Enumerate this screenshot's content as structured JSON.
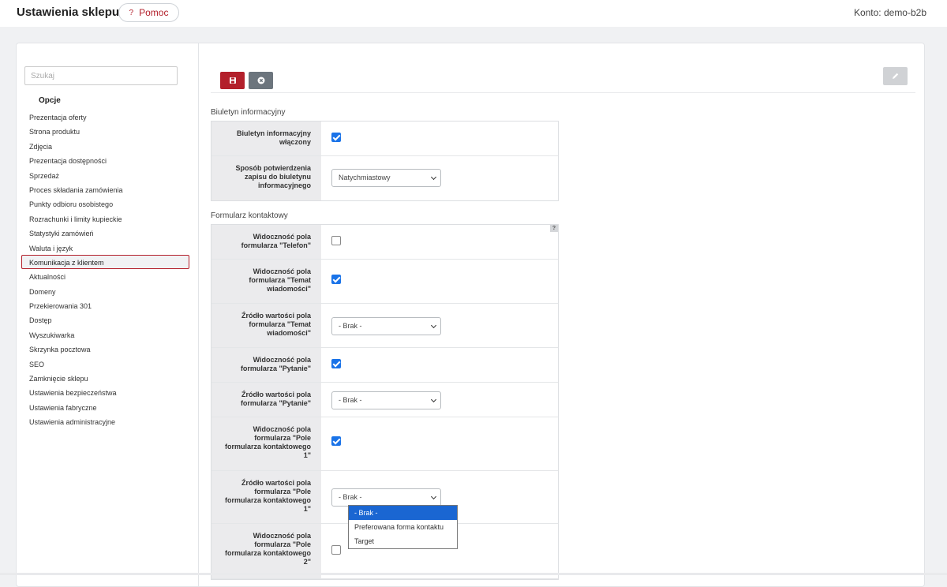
{
  "header": {
    "title": "Ustawienia sklepu",
    "help_label": "Pomoc",
    "help_icon": "?",
    "account": "Konto: demo-b2b"
  },
  "sidebar": {
    "search_placeholder": "Szukaj",
    "heading": "Opcje",
    "items": [
      "Prezentacja oferty",
      "Strona produktu",
      "Zdjęcia",
      "Prezentacja dostępności",
      "Sprzedaż",
      "Proces składania zamówienia",
      "Punkty odbioru osobistego",
      "Rozrachunki i limity kupieckie",
      "Statystyki zamówień",
      "Waluta i język",
      "Komunikacja z klientem",
      "Aktualności",
      "Domeny",
      "Przekierowania 301",
      "Dostęp",
      "Wyszukiwarka",
      "Skrzynka pocztowa",
      "SEO",
      "Zamknięcie sklepu",
      "Ustawienia bezpieczeństwa",
      "Ustawienia fabryczne",
      "Ustawienia administracyjne"
    ],
    "active_item": "Komunikacja z klientem"
  },
  "toolbar": {
    "save_icon": "save-icon",
    "cancel_icon": "cancel-icon",
    "edit_icon": "pencil-icon"
  },
  "newsletter": {
    "title": "Biuletyn informacyjny",
    "rows": [
      {
        "label": "Biuletyn informacyjny włączony",
        "type": "checkbox",
        "checked": true
      },
      {
        "label": "Sposób potwierdzenia zapisu do biuletynu informacyjnego",
        "type": "select",
        "value": "Natychmiastowy"
      }
    ]
  },
  "contact_form": {
    "title": "Formularz kontaktowy",
    "help_icon": "?",
    "rows": [
      {
        "label": "Widoczność pola formularza \"Telefon\"",
        "type": "checkbox",
        "checked": false
      },
      {
        "label": "Widoczność pola formularza \"Temat wiadomości\"",
        "type": "checkbox",
        "checked": true
      },
      {
        "label": "Źródło wartości pola formularza \"Temat wiadomości\"",
        "type": "select",
        "value": "- Brak -"
      },
      {
        "label": "Widoczność pola formularza \"Pytanie\"",
        "type": "checkbox",
        "checked": true
      },
      {
        "label": "Źródło wartości pola formularza \"Pytanie\"",
        "type": "select",
        "value": "- Brak -"
      },
      {
        "label": "Widoczność pola formularza \"Pole formularza kontaktowego 1\"",
        "type": "checkbox",
        "checked": true
      },
      {
        "label": "Źródło wartości pola formularza \"Pole formularza kontaktowego 1\"",
        "type": "select",
        "value": "- Brak -"
      },
      {
        "label": "Widoczność pola formularza \"Pole formularza kontaktowego 2\"",
        "type": "checkbox",
        "checked": false
      }
    ]
  },
  "open_dropdown": {
    "options": [
      "- Brak -",
      "Preferowana forma kontaktu",
      "Target"
    ],
    "selected": "- Brak -"
  },
  "colors": {
    "accent": "#b3202b",
    "checkbox": "#1a73e8",
    "selected_option": "#1a66d2"
  }
}
